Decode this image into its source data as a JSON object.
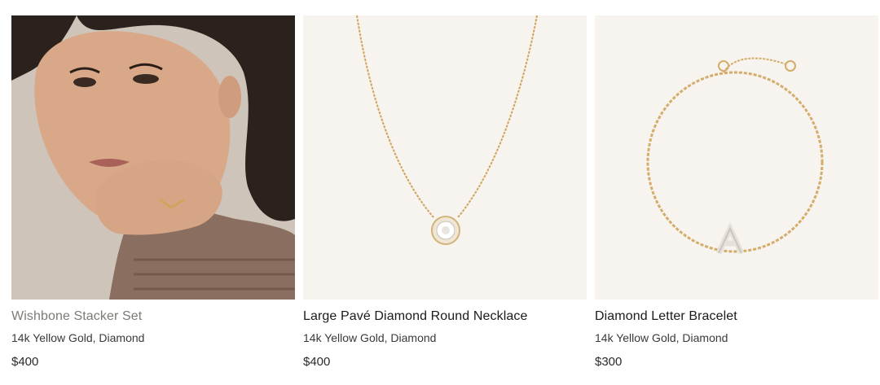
{
  "products": [
    {
      "name": "Wishbone Stacker Set",
      "material": "14k Yellow Gold, Diamond",
      "price": "$400",
      "image_icon": "model-wearing-ring-image"
    },
    {
      "name": "Large Pavé Diamond Round Necklace",
      "material": "14k Yellow Gold, Diamond",
      "price": "$400",
      "image_icon": "necklace-image"
    },
    {
      "name": "Diamond Letter Bracelet",
      "material": "14k Yellow Gold, Diamond",
      "price": "$300",
      "image_icon": "bracelet-image"
    }
  ],
  "colors": {
    "image_bg": "#f7f3ee",
    "gold": "#d4ad6a",
    "muted_text": "#7d7a77"
  }
}
